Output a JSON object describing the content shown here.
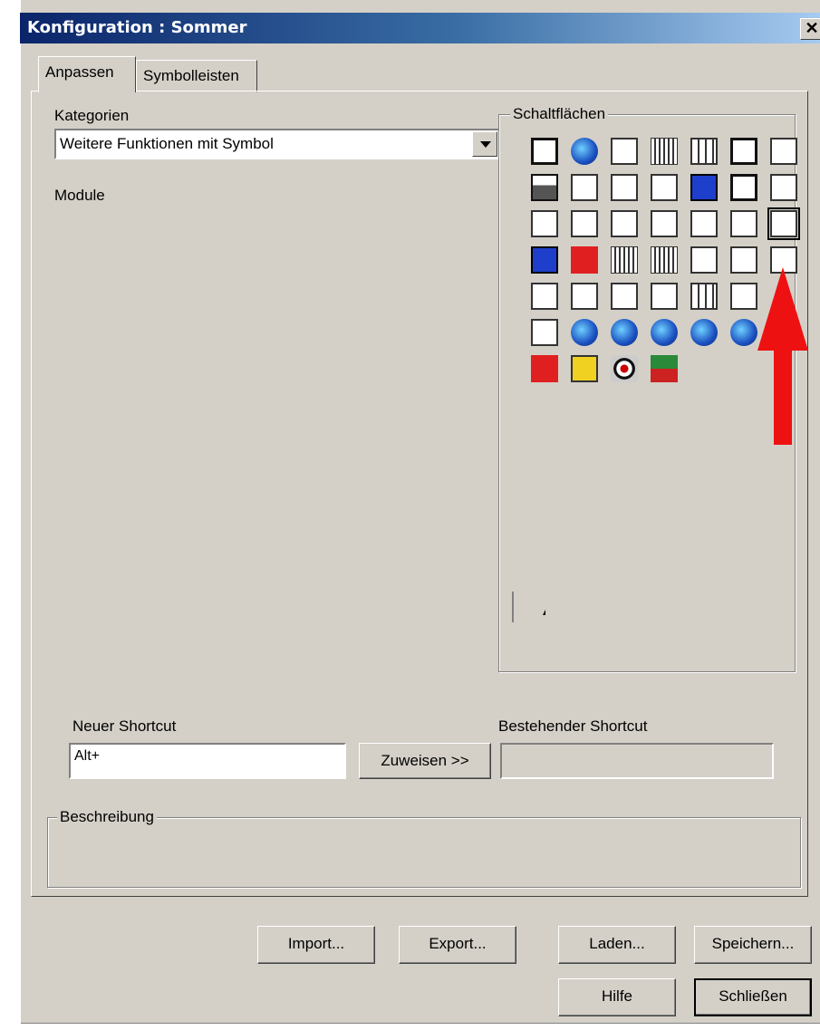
{
  "window": {
    "title": "Konfiguration : Sommer",
    "close_label": "✕"
  },
  "tabs": [
    {
      "label": "Anpassen",
      "active": true
    },
    {
      "label": "Symbolleisten",
      "active": false
    }
  ],
  "kategorien": {
    "label": "Kategorien",
    "selected": "Weitere Funktionen mit Symbol"
  },
  "module": {
    "label": "Module"
  },
  "schaltflaechen": {
    "label": "Schaltflächen",
    "icons": [
      "blank-window-icon",
      "globe-link-icon",
      "list-panel-icon",
      "3d-hatch-icon",
      "grid-icon",
      "frame-icon",
      "select-arrow-icon",
      "printer-icon",
      "line-bar-icon",
      "layer-bar-icon",
      "split-panel-icon",
      "blue-swap-icon",
      "cross-frame-icon",
      "paste-icon",
      "cube-icon",
      "rotate-icon",
      "pen-line-icon",
      "measure-icon",
      "pointer-stairs-icon",
      "stairs-icon",
      "image-edit-icon",
      "rotate-blue-icon",
      "red-lines-icon",
      "vertical-hatch-icon",
      "horizontal-hatch-icon",
      "wave-bar-icon",
      "split-measure-icon",
      "sparkle-icon",
      "dimension-icon",
      "box-question-icon",
      "house-dollar-icon",
      "mesh-icon",
      "grid-corner-icon",
      "panel-icon",
      "empty-icon",
      "box-link-icon",
      "globe-blue-1-icon",
      "globe-blue-2-icon",
      "globe-blue-3-icon",
      "globe-blue-4-icon",
      "globe-blue-5-icon",
      "empty-icon",
      "red-s-icon",
      "yellow-tool-icon",
      "target-icon",
      "green-split-icon"
    ],
    "selected_index": 20
  },
  "shortcut": {
    "new_label": "Neuer Shortcut",
    "new_value": "Alt+",
    "assign_label": "Zuweisen >>",
    "existing_label": "Bestehender Shortcut",
    "existing_value": ""
  },
  "beschreibung": {
    "label": "Beschreibung",
    "value": ""
  },
  "buttons": {
    "import": "Import...",
    "export": "Export...",
    "laden": "Laden...",
    "speichern": "Speichern...",
    "hilfe": "Hilfe",
    "schliessen": "Schließen"
  },
  "colors": {
    "title_start": "#0a246a",
    "title_end": "#a6caf0",
    "face": "#d4d0c8",
    "arrow": "#ee1111"
  }
}
